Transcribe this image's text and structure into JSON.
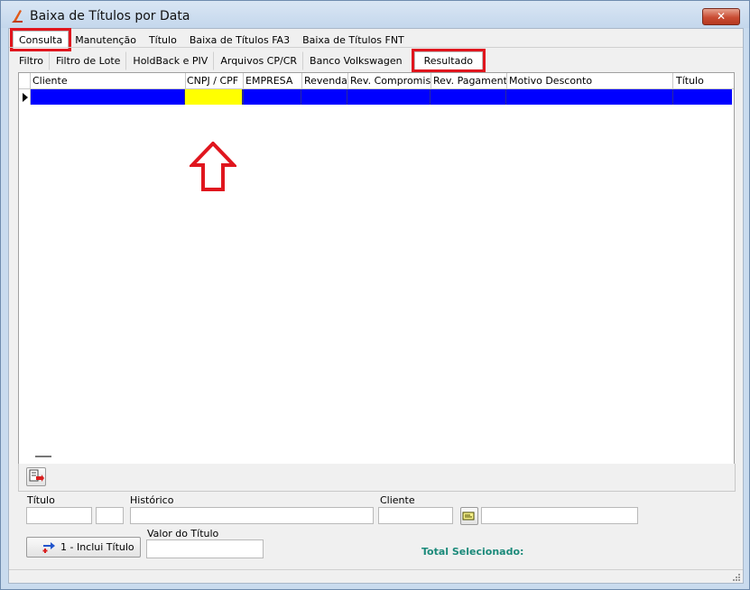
{
  "window": {
    "title": "Baixa de Títulos por Data",
    "close_label": "✕"
  },
  "main_tabs": [
    "Consulta",
    "Manutenção",
    "Título",
    "Baixa de Títulos FA3",
    "Baixa de Títulos FNT"
  ],
  "sub_tabs": [
    "Filtro",
    "Filtro de Lote",
    "HoldBack e PIV",
    "Arquivos CP/CR",
    "Banco Volkswagen",
    "Resultado"
  ],
  "grid": {
    "columns": [
      "Cliente",
      "CNPJ / CPF",
      "EMPRESA",
      "Revenda",
      "Rev. Compromisso",
      "Rev. Pagamento",
      "Motivo Desconto",
      "Título"
    ],
    "selected_row_color": "#0000ff",
    "highlight_cell_color": "#ffff00"
  },
  "form": {
    "titulo_label": "Título",
    "historico_label": "Histórico",
    "cliente_label": "Cliente",
    "valor_label": "Valor do Título",
    "inclui_button_label": "1 - Inclui Título",
    "total_label": "Total Selecionado:",
    "total_color": "#1b8a7a"
  },
  "annotation_color": "#e0161e"
}
